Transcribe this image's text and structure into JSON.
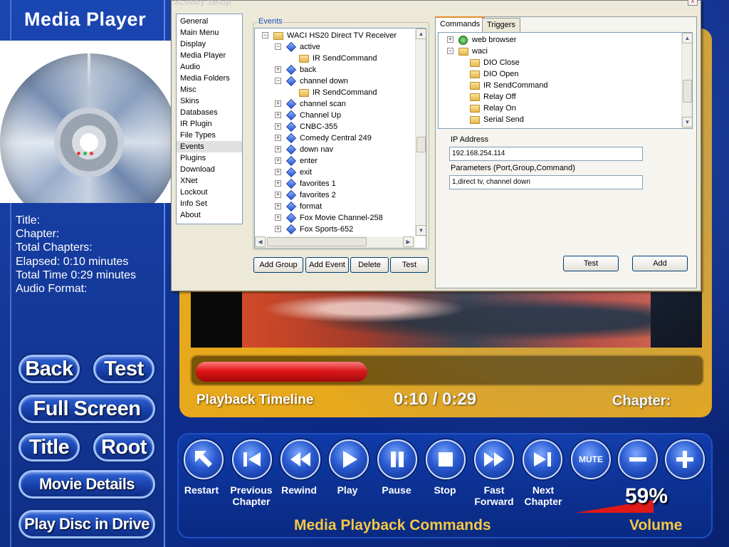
{
  "app": {
    "title": "Media Player"
  },
  "info": {
    "title_label": "Title:",
    "chapter_label": "Chapter:",
    "total_chapters_label": "Total Chapters:",
    "elapsed": "Elapsed: 0:10 minutes",
    "total_time": "Total Time 0:29 minutes",
    "audio_format_label": "Audio Format:"
  },
  "side_buttons": {
    "back": "Back",
    "test": "Test",
    "full_screen": "Full Screen",
    "title": "Title",
    "root": "Root",
    "movie_details": "Movie Details",
    "play_disc": "Play Disc in Drive"
  },
  "timeline": {
    "label": "Playback Timeline",
    "time": "0:10 / 0:29",
    "chapter_label": "Chapter:",
    "progress_fraction": 0.345
  },
  "controls": {
    "restart": "Restart",
    "previous_chapter": "Previous Chapter",
    "rewind": "Rewind",
    "play": "Play",
    "pause": "Pause",
    "stop": "Stop",
    "fast_forward": "Fast Forward",
    "next_chapter": "Next Chapter",
    "mute": "MUTE",
    "caption": "Media Playback Commands",
    "volume_caption": "Volume",
    "volume_percent": "59%",
    "volume_level": 0.59
  },
  "dialog": {
    "title": "xLobby Setup",
    "close": "x",
    "nav": [
      "General",
      "Main Menu",
      "Display",
      "Media Player",
      "Audio",
      "Media Folders",
      "Misc",
      "Skins",
      "Databases",
      "IR Plugin",
      "File Types",
      "Events",
      "Plugins",
      "Download",
      "XNet",
      "Lockout",
      "Info Set",
      "About"
    ],
    "nav_selected": "Events",
    "events_label": "Events",
    "events_tree": [
      {
        "text": "WACI HS20 Direct TV Receiver",
        "depth": 0,
        "icon": "folder-icon",
        "exp": "−"
      },
      {
        "text": "active",
        "depth": 1,
        "icon": "event-icon",
        "exp": "−"
      },
      {
        "text": "IR SendCommand",
        "depth": 2,
        "icon": "folder-icon",
        "exp": ""
      },
      {
        "text": "back",
        "depth": 1,
        "icon": "event-icon",
        "exp": "+"
      },
      {
        "text": "channel down",
        "depth": 1,
        "icon": "event-icon",
        "exp": "−"
      },
      {
        "text": "IR SendCommand",
        "depth": 2,
        "icon": "folder-icon",
        "exp": ""
      },
      {
        "text": "channel scan",
        "depth": 1,
        "icon": "event-icon",
        "exp": "+"
      },
      {
        "text": "Channel Up",
        "depth": 1,
        "icon": "event-icon",
        "exp": "+"
      },
      {
        "text": "CNBC-355",
        "depth": 1,
        "icon": "event-icon",
        "exp": "+"
      },
      {
        "text": "Comedy Central 249",
        "depth": 1,
        "icon": "event-icon",
        "exp": "+"
      },
      {
        "text": "down nav",
        "depth": 1,
        "icon": "event-icon",
        "exp": "+"
      },
      {
        "text": "enter",
        "depth": 1,
        "icon": "event-icon",
        "exp": "+"
      },
      {
        "text": "exit",
        "depth": 1,
        "icon": "event-icon",
        "exp": "+"
      },
      {
        "text": "favorites 1",
        "depth": 1,
        "icon": "event-icon",
        "exp": "+"
      },
      {
        "text": "favorites 2",
        "depth": 1,
        "icon": "event-icon",
        "exp": "+"
      },
      {
        "text": "format",
        "depth": 1,
        "icon": "event-icon",
        "exp": "+"
      },
      {
        "text": "Fox Movie Channel-258",
        "depth": 1,
        "icon": "event-icon",
        "exp": "+"
      },
      {
        "text": "Fox Sports-652",
        "depth": 1,
        "icon": "event-icon",
        "exp": "+"
      }
    ],
    "event_buttons": {
      "add_group": "Add Group",
      "add_event": "Add Event",
      "delete": "Delete",
      "test": "Test"
    },
    "tabs": {
      "commands": "Commands",
      "triggers": "Triggers"
    },
    "commands_tree": [
      {
        "text": "web browser",
        "depth": 0,
        "icon": "globe-icon",
        "exp": "+"
      },
      {
        "text": "waci",
        "depth": 0,
        "icon": "folder-icon",
        "exp": "−"
      },
      {
        "text": "DIO Close",
        "depth": 1,
        "icon": "folder-icon",
        "exp": ""
      },
      {
        "text": "DIO Open",
        "depth": 1,
        "icon": "folder-icon",
        "exp": ""
      },
      {
        "text": "IR SendCommand",
        "depth": 1,
        "icon": "folder-icon",
        "exp": ""
      },
      {
        "text": "Relay Off",
        "depth": 1,
        "icon": "folder-icon",
        "exp": ""
      },
      {
        "text": "Relay On",
        "depth": 1,
        "icon": "folder-icon",
        "exp": ""
      },
      {
        "text": "Serial Send",
        "depth": 1,
        "icon": "folder-icon",
        "exp": ""
      }
    ],
    "ip_label": "IP Address",
    "ip_value": "192.168.254.114",
    "params_label": "Parameters  (Port,Group,Command)",
    "params_value": "1,direct tv, channel down",
    "cmd_buttons": {
      "test": "Test",
      "add": "Add"
    }
  }
}
